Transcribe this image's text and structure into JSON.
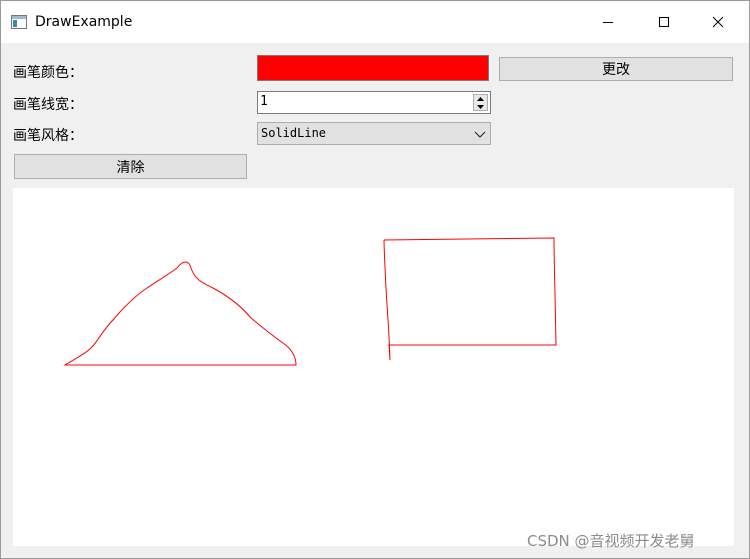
{
  "window": {
    "title": "DrawExample",
    "icon": "app-window-icon"
  },
  "controls": {
    "pen_color_label": "画笔颜色：",
    "pen_color_value": "#ff0000",
    "change_button": "更改",
    "pen_width_label": "画笔线宽：",
    "pen_width_value": "1",
    "pen_style_label": "画笔风格：",
    "pen_style_value": "SolidLine",
    "clear_button": "清除"
  },
  "canvas": {
    "background": "#ffffff",
    "stroke_color": "#ff0000"
  },
  "watermark": "CSDN @音视频开发老舅"
}
